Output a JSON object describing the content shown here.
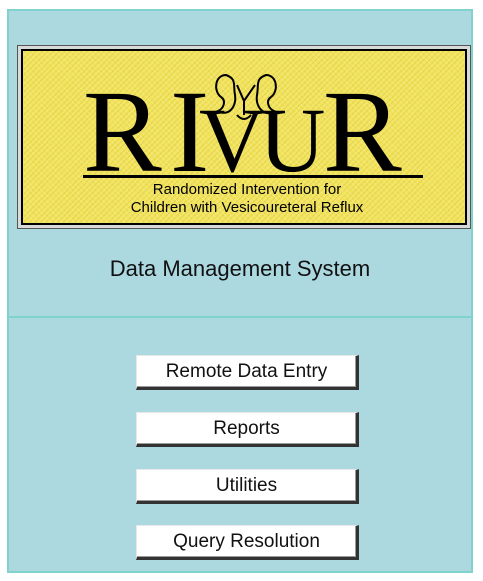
{
  "logo": {
    "wordmark": "RIVUR",
    "tagline_line1": "Randomized Intervention for",
    "tagline_line2": "Children with Vesicoureteral Reflux",
    "background_color": "#f1e35b",
    "emblem_icon": "kidney-emblem-icon"
  },
  "header": {
    "title": "Data Management System"
  },
  "menu": {
    "buttons": [
      {
        "label": "Remote Data Entry"
      },
      {
        "label": "Reports"
      },
      {
        "label": "Utilities"
      },
      {
        "label": "Query Resolution"
      }
    ]
  },
  "colors": {
    "panel_background": "#acd8e0",
    "border": "#7fd3cc",
    "button_face": "#ffffff"
  }
}
